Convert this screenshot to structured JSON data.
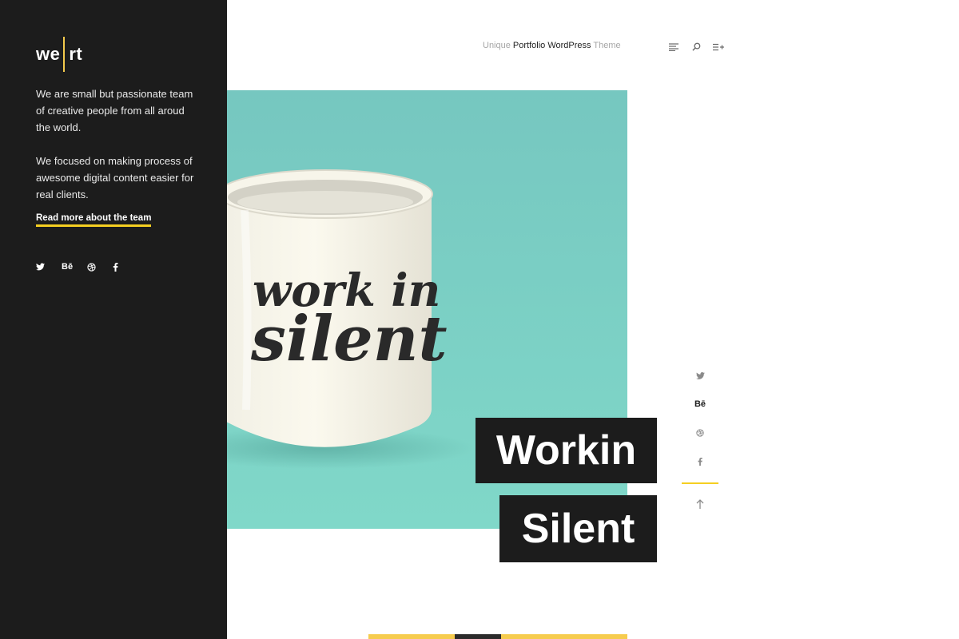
{
  "sidebar": {
    "logo": {
      "left": "we",
      "right": "rt"
    },
    "about_p1": "We are small but passionate team of creative people from all aroud the world.",
    "about_p2": "We focused on making process of awesome digital content easier for real clients.",
    "read_more": "Read more about the team",
    "social": [
      {
        "icon": "twitter-icon"
      },
      {
        "icon": "behance-icon",
        "text": "Bē"
      },
      {
        "icon": "dribbble-icon"
      },
      {
        "icon": "facebook-icon"
      }
    ]
  },
  "header": {
    "tagline_pre": "Unique",
    "tagline_strong": "Portfolio WordPress",
    "tagline_post": "Theme",
    "tools": [
      "menu-lines-icon",
      "search-icon",
      "playlist-add-icon"
    ]
  },
  "hero": {
    "mug_line1": "work in",
    "mug_line2": "silent",
    "title_line1": "Workin",
    "title_line2": "Silent"
  },
  "share": {
    "behance_text": "Bē"
  },
  "colors": {
    "sidebar_bg": "#1c1c1c",
    "accent": "#f5cf21",
    "hero_bg": "#7dd0c5",
    "title_bg": "#1c1c1c"
  }
}
